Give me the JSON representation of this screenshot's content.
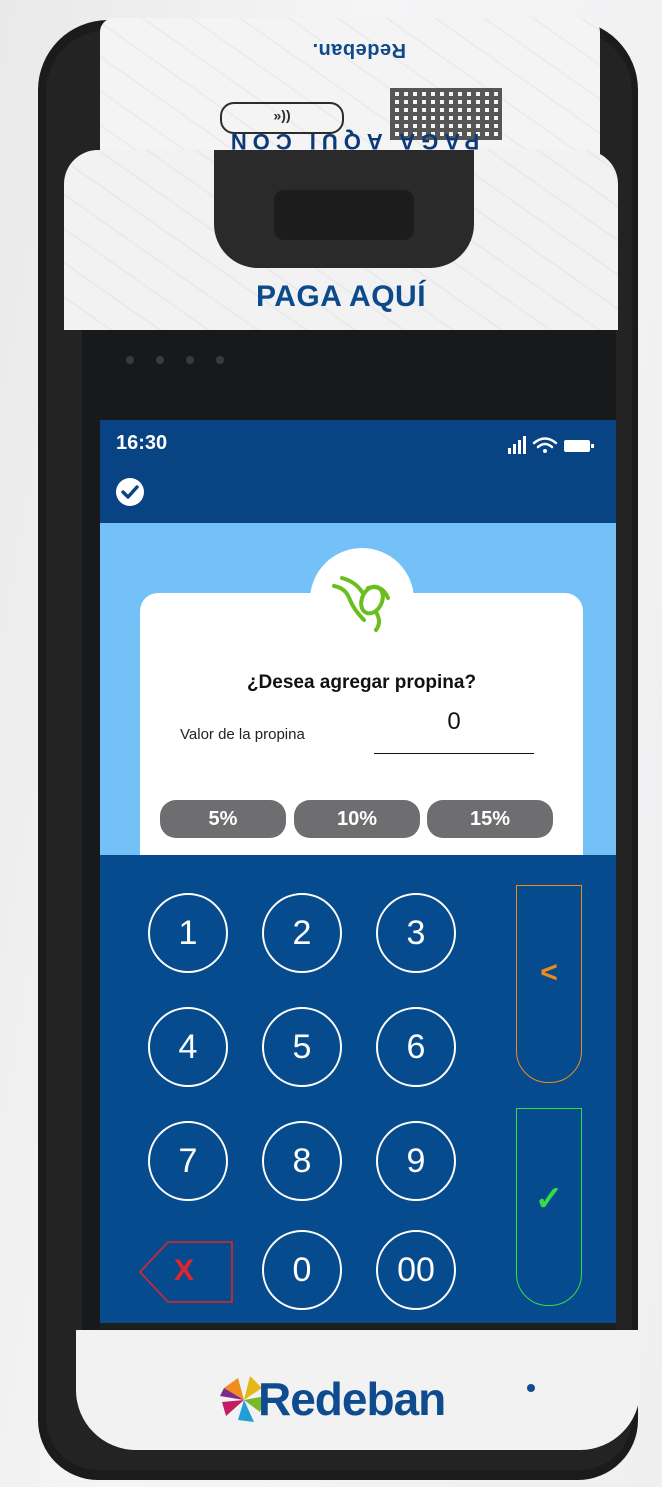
{
  "device": {
    "top_brand_mirrored": "Redeban.",
    "nfc_mark": "((«",
    "top_text_mirrored": "PAGA AQUI CON",
    "paga_aqui": "PAGA AQUÍ",
    "bottom_brand": "Redeban"
  },
  "status_bar": {
    "time": "16:30",
    "icons": [
      "signal-icon",
      "wifi-icon",
      "battery-icon"
    ]
  },
  "header": {
    "icon": "check-circle-icon"
  },
  "tip_card": {
    "icon": "hand-coin-icon",
    "question": "¿Desea agregar propina?",
    "field_label": "Valor de la propina",
    "field_value": "0",
    "percent_options": [
      "5%",
      "10%",
      "15%"
    ]
  },
  "keypad": {
    "keys": [
      "1",
      "2",
      "3",
      "4",
      "5",
      "6",
      "7",
      "8",
      "9",
      "0",
      "00"
    ],
    "delete_label": "X",
    "back_label": "<",
    "ok_label": "✓"
  },
  "colors": {
    "header_blue": "#084383",
    "screen_bg": "#74c1f8",
    "keypad_blue": "#074b8f",
    "brand_blue": "#0c4a8c",
    "back_orange": "#f08a1b",
    "ok_green": "#39d84a",
    "delete_red": "#e0262b",
    "tip_icon_green": "#6abe20",
    "percent_button": "#6e6e70"
  }
}
